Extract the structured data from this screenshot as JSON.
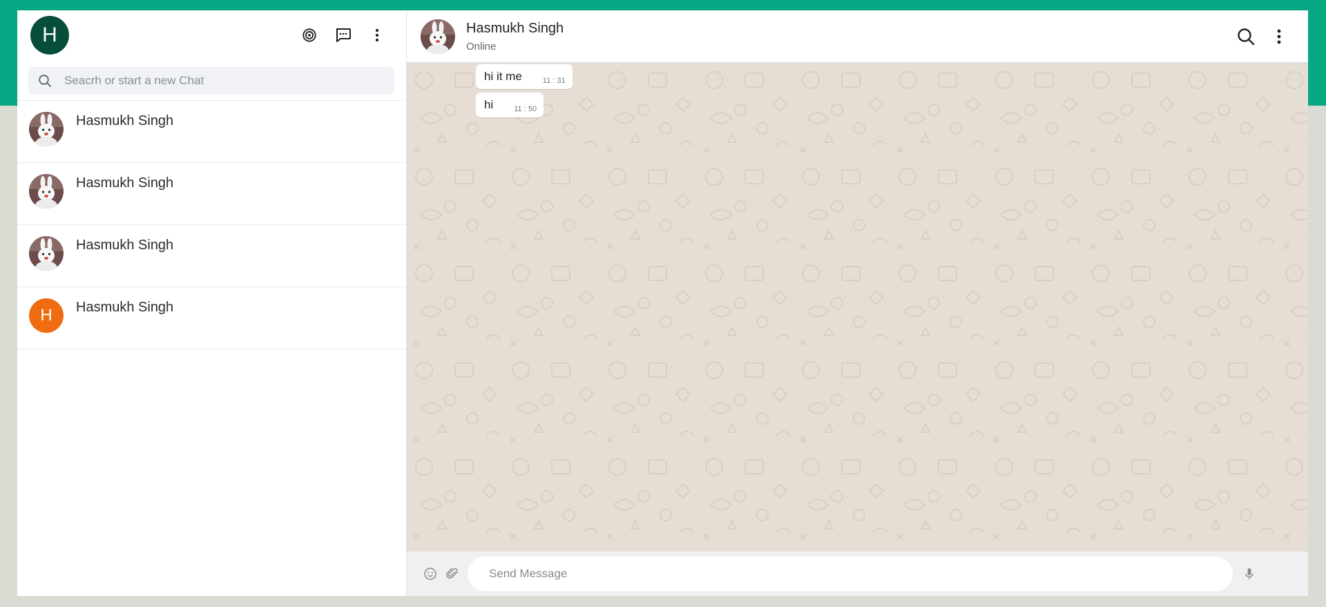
{
  "user": {
    "avatar_letter": "H"
  },
  "left_header": {
    "icons": [
      "status-icon",
      "new-chat-icon",
      "menu-dots-icon"
    ]
  },
  "search": {
    "placeholder": "Seacrh or start a new Chat"
  },
  "chats": [
    {
      "name": "Hasmukh Singh",
      "avatar": "bunny-photo"
    },
    {
      "name": "Hasmukh Singh",
      "avatar": "bunny-photo"
    },
    {
      "name": "Hasmukh Singh",
      "avatar": "bunny-photo"
    },
    {
      "name": "Hasmukh Singh",
      "avatar_letter": "H"
    }
  ],
  "conversation": {
    "name": "Hasmukh Singh",
    "status": "Online",
    "messages": [
      {
        "text": "hi it me",
        "time": "11 : 31"
      },
      {
        "text": "hi",
        "time": "11 : 50"
      }
    ]
  },
  "composer": {
    "placeholder": "Send Message"
  },
  "colors": {
    "top_band": "#06a884",
    "user_avatar": "#064e3b",
    "letter_avatar": "#ef6c10",
    "chat_background": "#e6ded5"
  }
}
